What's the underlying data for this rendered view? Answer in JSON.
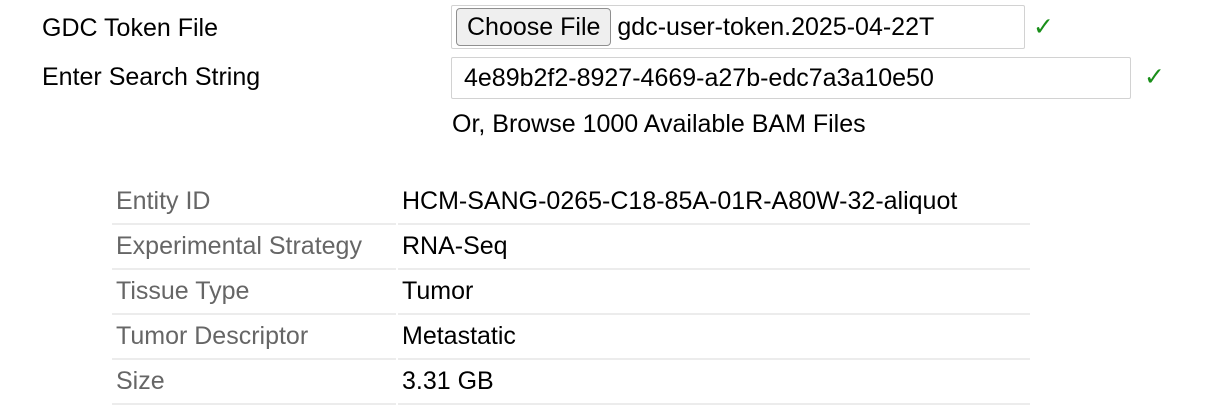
{
  "token": {
    "label": "GDC Token File",
    "button_label": "Choose File",
    "file_name": "gdc-user-token.2025-04-22T",
    "check": "✓"
  },
  "search": {
    "label": "Enter Search String",
    "value": "4e89b2f2-8927-4669-a27b-edc7a3a10e50",
    "check": "✓"
  },
  "browse": {
    "text": "Or, Browse 1000 Available BAM Files"
  },
  "details": [
    {
      "key": "Entity ID",
      "value": "HCM-SANG-0265-C18-85A-01R-A80W-32-aliquot"
    },
    {
      "key": "Experimental Strategy",
      "value": "RNA-Seq"
    },
    {
      "key": "Tissue Type",
      "value": "Tumor"
    },
    {
      "key": "Tumor Descriptor",
      "value": "Metastatic"
    },
    {
      "key": "Size",
      "value": "3.31 GB"
    }
  ],
  "colors": {
    "check": "#1a8f1a",
    "key_text": "#666666",
    "row_border": "#ececec"
  }
}
